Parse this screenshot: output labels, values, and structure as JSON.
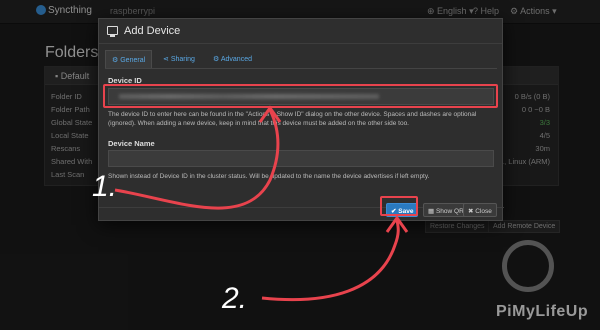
{
  "app": {
    "brand": "Syncthing",
    "host": "raspberrypi",
    "nav": {
      "language": "English",
      "help": "Help",
      "actions": "Actions"
    },
    "folders_heading": "Folders",
    "folder_panel_title": "Default",
    "rows": [
      {
        "label": "Folder ID",
        "value": ""
      },
      {
        "label": "Folder Path",
        "value": "0 B/s (0 B)"
      },
      {
        "label": "Global State",
        "value": "0  0  ~0 B"
      },
      {
        "label": "Local State",
        "value": "3/3"
      },
      {
        "label": "Rescans",
        "value": "4/5"
      },
      {
        "label": "Shared With",
        "value": "30m"
      },
      {
        "label": "Last Scan",
        "value": "2.1, Linux (ARM)"
      }
    ],
    "bg_buttons": {
      "restore": "Restore Changes",
      "add_remote": "Add Remote Device"
    }
  },
  "modal": {
    "title": "Add Device",
    "tabs": [
      {
        "label": "General",
        "icon": "gear-icon"
      },
      {
        "label": "Sharing",
        "icon": "share-icon"
      },
      {
        "label": "Advanced",
        "icon": "cogs-icon"
      }
    ],
    "device_id_label": "Device ID",
    "device_id_help": "The device ID to enter here can be found in the \"Actions > Show ID\" dialog on the other device. Spaces and dashes are optional (ignored). When adding a new device, keep in mind that this device must be added on the other side too.",
    "device_name_label": "Device Name",
    "device_name_help": "Shown instead of Device ID in the cluster status. Will be updated to the name the device advertises if left empty.",
    "buttons": {
      "save": "Save",
      "show_qr": "Show QR",
      "close": "Close"
    }
  },
  "annotations": {
    "step1": "1.",
    "step2": "2."
  },
  "watermark": "PiMyLifeUp",
  "colors": {
    "accent": "#2a7ac0",
    "highlight": "#e8434d",
    "link": "#5aa9e6"
  }
}
